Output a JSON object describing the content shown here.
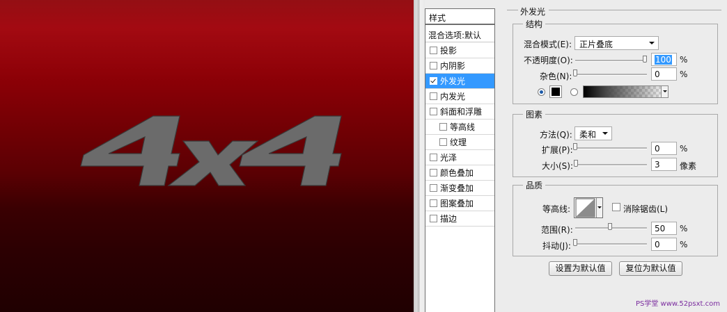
{
  "canvas": {
    "logo_text": "4x4"
  },
  "styles_panel": {
    "header": "样式",
    "blend_options": "混合选项:默认",
    "items": [
      {
        "label": "投影",
        "checked": false,
        "selected": false,
        "indent": false
      },
      {
        "label": "内阴影",
        "checked": false,
        "selected": false,
        "indent": false
      },
      {
        "label": "外发光",
        "checked": true,
        "selected": true,
        "indent": false
      },
      {
        "label": "内发光",
        "checked": false,
        "selected": false,
        "indent": false
      },
      {
        "label": "斜面和浮雕",
        "checked": false,
        "selected": false,
        "indent": false
      },
      {
        "label": "等高线",
        "checked": false,
        "selected": false,
        "indent": true
      },
      {
        "label": "纹理",
        "checked": false,
        "selected": false,
        "indent": true
      },
      {
        "label": "光泽",
        "checked": false,
        "selected": false,
        "indent": false
      },
      {
        "label": "颜色叠加",
        "checked": false,
        "selected": false,
        "indent": false
      },
      {
        "label": "渐变叠加",
        "checked": false,
        "selected": false,
        "indent": false
      },
      {
        "label": "图案叠加",
        "checked": false,
        "selected": false,
        "indent": false
      },
      {
        "label": "描边",
        "checked": false,
        "selected": false,
        "indent": false
      }
    ]
  },
  "outer_glow": {
    "title": "外发光",
    "structure": {
      "title": "结构",
      "blend_mode_label": "混合模式(E):",
      "blend_mode_value": "正片叠底",
      "opacity_label": "不透明度(O):",
      "opacity_value": "100",
      "opacity_level": 100,
      "noise_label": "杂色(N):",
      "noise_value": "0",
      "noise_level": 0,
      "percent": "%",
      "glow_color": "#000000"
    },
    "elements": {
      "title": "图素",
      "technique_label": "方法(Q):",
      "technique_value": "柔和",
      "spread_label": "扩展(P):",
      "spread_value": "0",
      "spread_level": 0,
      "size_label": "大小(S):",
      "size_value": "3",
      "size_level": 3,
      "percent": "%",
      "pixel_unit": "像素"
    },
    "quality": {
      "title": "品质",
      "contour_label": "等高线:",
      "anti_alias_label": "消除锯齿(L)",
      "anti_alias_checked": false,
      "range_label": "范围(R):",
      "range_value": "50",
      "range_level": 50,
      "jitter_label": "抖动(J):",
      "jitter_value": "0",
      "jitter_level": 0,
      "percent": "%"
    },
    "set_default_button": "设置为默认值",
    "reset_default_button": "复位为默认值"
  },
  "watermark": "PS学堂 www.52psxt.com"
}
